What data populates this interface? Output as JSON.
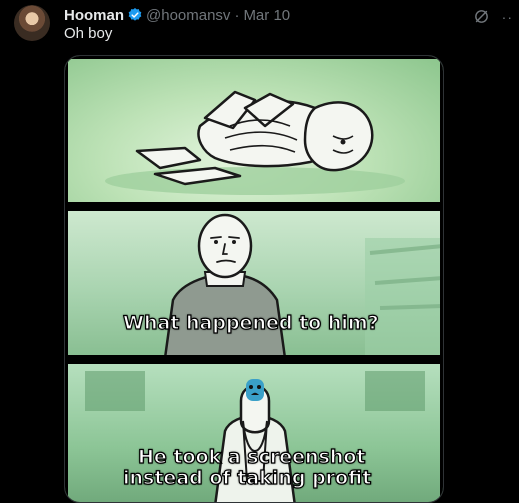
{
  "tweet": {
    "author_name": "Hooman",
    "author_handle": "@hoomansv",
    "separator": "·",
    "date": "Mar 10",
    "text": "Oh boy"
  },
  "meme": {
    "caption_panel_2": "What happened to him?",
    "caption_panel_3_line1": "He took a screenshot",
    "caption_panel_3_line2": "instead of taking profit"
  },
  "icons": {
    "verified": "verified-badge-icon",
    "grok": "grok-icon",
    "more": "more-icon"
  },
  "colors": {
    "background": "#000000",
    "text": "#e7e9ea",
    "muted": "#71767b",
    "verified": "#1d9bf0",
    "panel_green": "#bde2b6"
  }
}
